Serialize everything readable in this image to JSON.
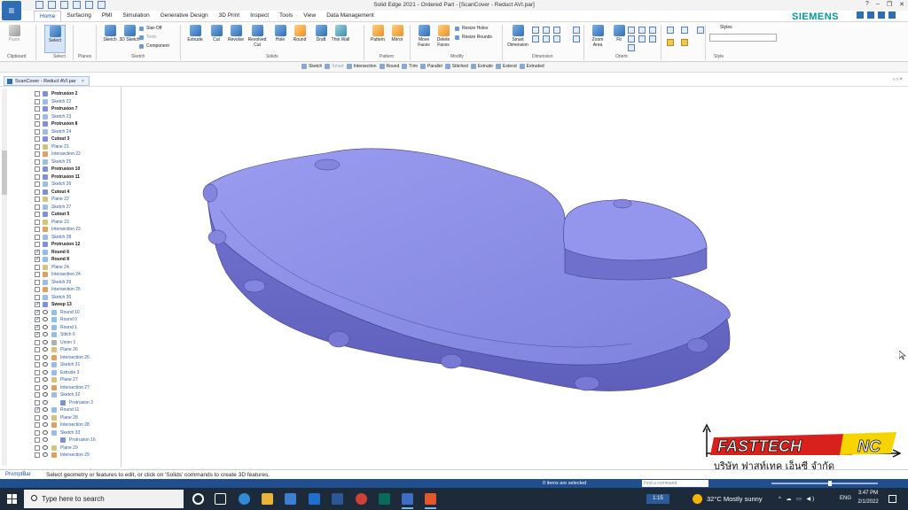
{
  "window": {
    "title": "Solid Edge 2021 - Ordered Part - [ScanCover - Reduct AVI.par]",
    "controls": [
      "?",
      "–",
      "❐",
      "✕"
    ]
  },
  "menu": {
    "tabs": [
      "Home",
      "Surfacing",
      "PMI",
      "Simulation",
      "Generative Design",
      "3D Print",
      "Inspect",
      "Tools",
      "View",
      "Data Management"
    ],
    "active": "Home"
  },
  "brand": "SIEMENS",
  "ribbon": {
    "buttons": [
      {
        "label": "Paste",
        "name": "paste",
        "dim": true
      },
      {
        "label": "Select",
        "name": "select"
      },
      {
        "label": "Sketch",
        "name": "sketch"
      },
      {
        "label": "3D Sketch",
        "name": "3d-sketch"
      },
      {
        "label": "Extrude",
        "name": "extrude"
      },
      {
        "label": "Cut",
        "name": "cut"
      },
      {
        "label": "Revolve",
        "name": "revolve"
      },
      {
        "label": "Revolved Cut",
        "name": "revolved-cut"
      },
      {
        "label": "Hole",
        "name": "hole"
      },
      {
        "label": "Round",
        "name": "round"
      },
      {
        "label": "Draft",
        "name": "draft"
      },
      {
        "label": "Thin Wall",
        "name": "thin-wall"
      },
      {
        "label": "Pattern",
        "name": "pattern"
      },
      {
        "label": "Mirror",
        "name": "mirror"
      },
      {
        "label": "Move Faces",
        "name": "move-faces"
      },
      {
        "label": "Delete Faces",
        "name": "delete-faces"
      },
      {
        "label": "Smart Dimension",
        "name": "smart-dimension"
      },
      {
        "label": "Zoom Area",
        "name": "zoom-area"
      },
      {
        "label": "Fit",
        "name": "fit"
      }
    ],
    "small": {
      "star_off": "Star-Off",
      "tools": "Tools",
      "component": "Component",
      "resize_holes": "Resize Holes",
      "resize_rounds": "Resize Rounds",
      "styles": "Styles"
    },
    "groups": {
      "clipboard": "Clipboard",
      "select": "Select",
      "planes": "Planes",
      "sketch": "Sketch",
      "solids": "Solids",
      "pattern": "Pattern",
      "modify": "Modify",
      "dimension": "Dimension",
      "orient": "Orient",
      "style": "Style"
    }
  },
  "command_bar": [
    {
      "label": "Sketch",
      "dim": false
    },
    {
      "label": "Smart",
      "dim": true
    },
    {
      "label": "Intersection",
      "dim": false
    },
    {
      "label": "Round",
      "dim": false
    },
    {
      "label": "Trim",
      "dim": false
    },
    {
      "label": "Parallel",
      "dim": false
    },
    {
      "label": "Stitched",
      "dim": false
    },
    {
      "label": "Extrude",
      "dim": false
    },
    {
      "label": "Extend",
      "dim": false
    },
    {
      "label": "Extruded",
      "dim": false
    }
  ],
  "document_tab": {
    "label": "ScanCover - Reduct AVI.par",
    "close": "×",
    "right": "‹ ›  ×"
  },
  "pathfinder": {
    "items": [
      {
        "label": "Protrusion 2",
        "type": "pr",
        "checked": false,
        "indent": 0,
        "bold": true
      },
      {
        "label": "Sketch 22",
        "type": "sk",
        "checked": false,
        "indent": 0,
        "bold": false
      },
      {
        "label": "Protrusion 7",
        "type": "pr",
        "checked": false,
        "indent": 0,
        "bold": true
      },
      {
        "label": "Sketch 23",
        "type": "sk",
        "checked": false,
        "indent": 0,
        "bold": false
      },
      {
        "label": "Protrusion 8",
        "type": "pr",
        "checked": false,
        "indent": 0,
        "bold": true
      },
      {
        "label": "Sketch 24",
        "type": "sk",
        "checked": false,
        "indent": 0,
        "bold": false
      },
      {
        "label": "Cutout 3",
        "type": "pr",
        "checked": false,
        "indent": 0,
        "bold": true
      },
      {
        "label": "Plane 21",
        "type": "pl",
        "checked": false,
        "indent": 0,
        "bold": false
      },
      {
        "label": "Intersection 22",
        "type": "in",
        "checked": false,
        "indent": 0,
        "bold": false
      },
      {
        "label": "Sketch 25",
        "type": "sk",
        "checked": false,
        "indent": 0,
        "bold": false
      },
      {
        "label": "Protrusion 10",
        "type": "pr",
        "checked": false,
        "indent": 0,
        "bold": true
      },
      {
        "label": "Protrusion 11",
        "type": "pr",
        "checked": false,
        "indent": 0,
        "bold": true
      },
      {
        "label": "Sketch 26",
        "type": "sk",
        "checked": false,
        "indent": 0,
        "bold": false
      },
      {
        "label": "Cutout 4",
        "type": "pr",
        "checked": false,
        "indent": 0,
        "bold": true
      },
      {
        "label": "Plane 22",
        "type": "pl",
        "checked": false,
        "indent": 0,
        "bold": false
      },
      {
        "label": "Sketch 27",
        "type": "sk",
        "checked": false,
        "indent": 0,
        "bold": false
      },
      {
        "label": "Cutout 5",
        "type": "pr",
        "checked": false,
        "indent": 0,
        "bold": true
      },
      {
        "label": "Plane 23",
        "type": "pl",
        "checked": false,
        "indent": 0,
        "bold": false
      },
      {
        "label": "Intersection 23",
        "type": "in",
        "checked": false,
        "indent": 0,
        "bold": false
      },
      {
        "label": "Sketch 28",
        "type": "sk",
        "checked": false,
        "indent": 0,
        "bold": false
      },
      {
        "label": "Protrusion 12",
        "type": "pr",
        "checked": false,
        "indent": 0,
        "bold": true
      },
      {
        "label": "Round 6",
        "type": "ro",
        "checked": true,
        "indent": 0,
        "bold": true
      },
      {
        "label": "Round 8",
        "type": "ro",
        "checked": true,
        "indent": 0,
        "bold": true
      },
      {
        "label": "Plane 24",
        "type": "pl",
        "checked": false,
        "indent": 0,
        "bold": false
      },
      {
        "label": "Intersection 24",
        "type": "in",
        "checked": false,
        "indent": 0,
        "bold": false
      },
      {
        "label": "Sketch 29",
        "type": "sk",
        "checked": false,
        "indent": 0,
        "bold": false
      },
      {
        "label": "Intersection 25",
        "type": "in",
        "checked": false,
        "indent": 0,
        "bold": false
      },
      {
        "label": "Sketch 30",
        "type": "sk",
        "checked": false,
        "indent": 0,
        "bold": false
      },
      {
        "label": "Sweep 13",
        "type": "pr",
        "checked": true,
        "indent": 0,
        "bold": true
      },
      {
        "label": "Round 10",
        "type": "ro",
        "checked": true,
        "indent": 1,
        "bold": false
      },
      {
        "label": "Round 0",
        "type": "ro",
        "checked": true,
        "indent": 1,
        "bold": false
      },
      {
        "label": "Round 1",
        "type": "ro",
        "checked": true,
        "indent": 1,
        "bold": false
      },
      {
        "label": "Stitch 6",
        "type": "sk",
        "checked": true,
        "indent": 1,
        "bold": false
      },
      {
        "label": "Union 1",
        "type": "un",
        "checked": false,
        "indent": 1,
        "bold": false
      },
      {
        "label": "Plane 26",
        "type": "pl",
        "checked": false,
        "indent": 1,
        "bold": false
      },
      {
        "label": "Intersection 26",
        "type": "in",
        "checked": false,
        "indent": 1,
        "bold": false
      },
      {
        "label": "Sketch 31",
        "type": "sk",
        "checked": false,
        "indent": 1,
        "bold": false
      },
      {
        "label": "Extrude 3",
        "type": "sk",
        "checked": false,
        "indent": 1,
        "bold": false
      },
      {
        "label": "Plane 27",
        "type": "pl",
        "checked": false,
        "indent": 1,
        "bold": false
      },
      {
        "label": "Intersection 27",
        "type": "in",
        "checked": false,
        "indent": 1,
        "bold": false
      },
      {
        "label": "Sketch 32",
        "type": "sk",
        "checked": false,
        "indent": 1,
        "bold": false
      },
      {
        "label": "Protrusion 3",
        "type": "pr",
        "checked": false,
        "indent": 2,
        "bold": false
      },
      {
        "label": "Round 11",
        "type": "ro",
        "checked": true,
        "indent": 1,
        "bold": false
      },
      {
        "label": "Plane 28",
        "type": "pl",
        "checked": false,
        "indent": 1,
        "bold": false
      },
      {
        "label": "Intersection 28",
        "type": "in",
        "checked": false,
        "indent": 1,
        "bold": false
      },
      {
        "label": "Sketch 33",
        "type": "sk",
        "checked": false,
        "indent": 1,
        "bold": false
      },
      {
        "label": "Protrusion 16",
        "type": "pr",
        "checked": false,
        "indent": 2,
        "bold": false
      },
      {
        "label": "Plane 29",
        "type": "pl",
        "checked": false,
        "indent": 1,
        "bold": false
      },
      {
        "label": "Intersection 29",
        "type": "in",
        "checked": false,
        "indent": 1,
        "bold": false
      }
    ]
  },
  "model": {
    "fill": "#8c8ee6",
    "edge": "#3d3f8f"
  },
  "logo": {
    "word1": "FASTTECH",
    "word2": "NC",
    "thai": "บริษัท ฟาสท์เทค เอ็นซี จำกัด"
  },
  "prompt": {
    "label": "PromptBar",
    "text": "Select geometry or features to edit, or click on 'Solids' commands to create 3D features."
  },
  "status": {
    "selected": "0 items are selected",
    "find": "Find a command"
  },
  "taskbar": {
    "search_placeholder": "Type here to search",
    "clip_time": "1:15",
    "weather": "32°C  Mostly sunny",
    "lang": "ENG",
    "time": "3:47 PM",
    "date": "2/1/2022"
  }
}
